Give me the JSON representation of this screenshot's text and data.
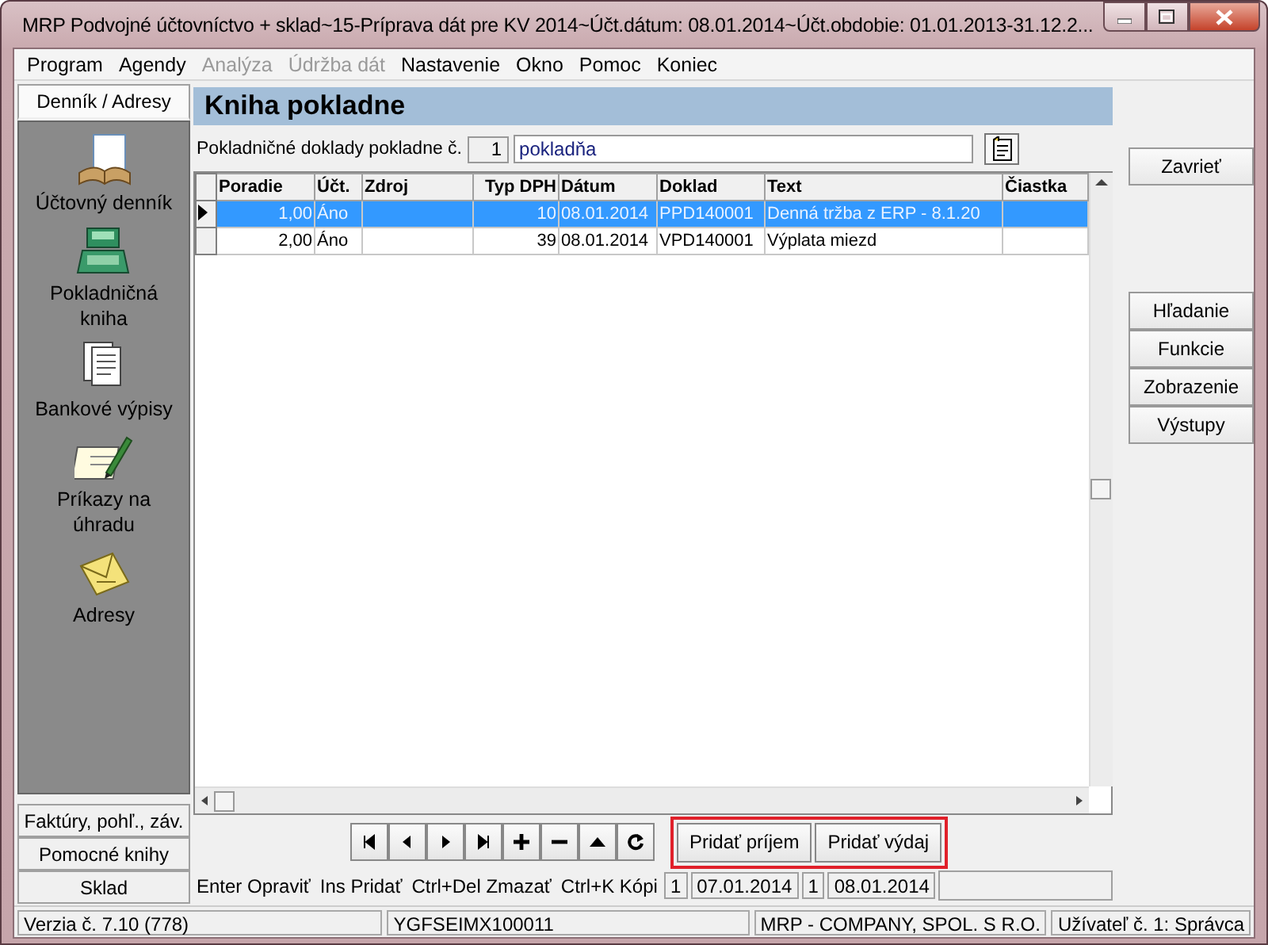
{
  "window": {
    "title": "MRP Podvojné účtovníctvo + sklad~15-Príprava dát pre KV 2014~Účt.dátum: 08.01.2014~Účt.obdobie: 01.01.2013-31.12.2..."
  },
  "menu": [
    {
      "label": "Program",
      "disabled": false
    },
    {
      "label": "Agendy",
      "disabled": false
    },
    {
      "label": "Analýza",
      "disabled": true
    },
    {
      "label": "Údržba dát",
      "disabled": true
    },
    {
      "label": "Nastavenie",
      "disabled": false
    },
    {
      "label": "Okno",
      "disabled": false
    },
    {
      "label": "Pomoc",
      "disabled": false
    },
    {
      "label": "Koniec",
      "disabled": false
    }
  ],
  "sidebar": {
    "tabs": [
      {
        "label": "Denník / Adresy",
        "selected": true,
        "items": [
          {
            "label": "Účtovný denník",
            "kind": "journal"
          },
          {
            "label": "Pokladničná kniha",
            "kind": "register"
          },
          {
            "label": "Bankové výpisy",
            "kind": "statements"
          },
          {
            "label": "Príkazy na úhradu",
            "kind": "orders"
          },
          {
            "label": "Adresy",
            "kind": "addresses"
          }
        ]
      },
      {
        "label": "Faktúry, pohľ., záv.",
        "selected": false
      },
      {
        "label": "Pomocné knihy",
        "selected": false
      },
      {
        "label": "Sklad",
        "selected": false
      }
    ]
  },
  "panel": {
    "title": "Kniha pokladne",
    "field_label": "Pokladničné doklady pokladne č.",
    "cash_number": "1",
    "cash_name": "pokladňa"
  },
  "table": {
    "columns": [
      "Poradie",
      "Účt.",
      "Zdroj",
      "Typ DPH",
      "Dátum",
      "Doklad",
      "Text",
      "Čiastka"
    ],
    "rows": [
      {
        "selected": true,
        "cells": [
          "1,00",
          "Áno",
          "",
          "10",
          "08.01.2014",
          "PPD140001",
          "Denná tržba z ERP - 8.1.20",
          ""
        ]
      },
      {
        "selected": false,
        "cells": [
          "2,00",
          "Áno",
          "",
          "39",
          "08.01.2014",
          "VPD140001",
          "Výplata miezd",
          ""
        ]
      }
    ]
  },
  "nav_buttons": [
    {
      "kind": "first"
    },
    {
      "kind": "prev"
    },
    {
      "kind": "next"
    },
    {
      "kind": "last"
    },
    {
      "kind": "add"
    },
    {
      "kind": "remove"
    },
    {
      "kind": "up"
    },
    {
      "kind": "refresh"
    }
  ],
  "add_buttons": {
    "highlighted": true,
    "items": [
      "Pridať príjem",
      "Pridať výdaj"
    ]
  },
  "hint_bar": {
    "hints": [
      "Enter Opraviť",
      "Ins Pridať",
      "Ctrl+Del Zmazať",
      "Ctrl+K Kópi"
    ],
    "fields": [
      "1",
      "07.01.2014",
      "1",
      "08.01.2014"
    ]
  },
  "side_buttons": {
    "top": [
      "Zavrieť"
    ],
    "bottom": [
      "Hľadanie",
      "Funkcie",
      "Zobrazenie",
      "Výstupy"
    ]
  },
  "status_bar": [
    "Verzia č. 7.10 (778)",
    "YGFSEIMX100011",
    "MRP - COMPANY, SPOL. S R.O.",
    "Užívateľ č. 1: Správca"
  ]
}
